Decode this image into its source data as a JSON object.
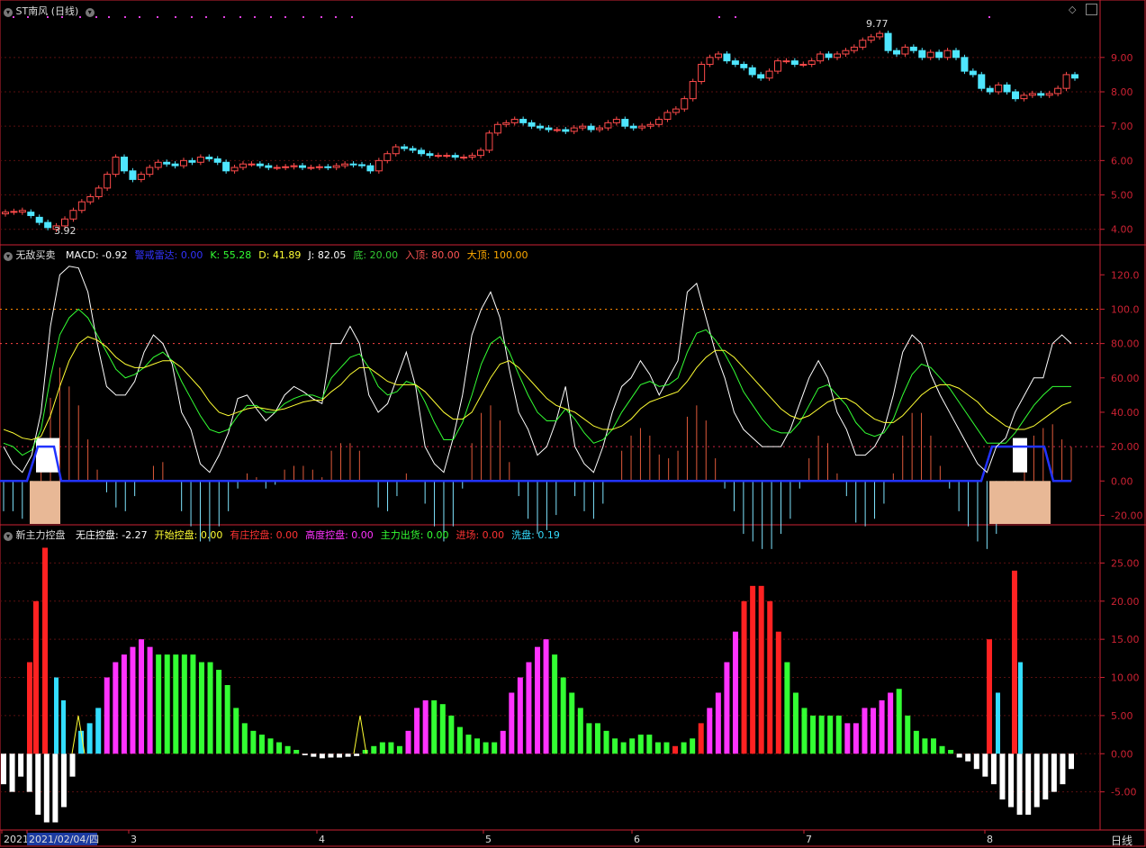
{
  "panel1": {
    "title": "ST南风 (日线)",
    "high_label": "9.77",
    "low_label": "3.92",
    "y_ticks": [
      "9.00",
      "8.00",
      "7.00",
      "6.00",
      "5.00",
      "4.00"
    ]
  },
  "panel2": {
    "name": "无敌买卖",
    "fields": [
      {
        "label": "MACD: -0.92",
        "color": "#ffffff"
      },
      {
        "label": "警戒雷达: 0.00",
        "color": "#3333ff"
      },
      {
        "label": "K: 55.28",
        "color": "#33ff33"
      },
      {
        "label": "D: 41.89",
        "color": "#ffff33"
      },
      {
        "label": "J: 82.05",
        "color": "#ffffff"
      },
      {
        "label": "底: 20.00",
        "color": "#33cc33"
      },
      {
        "label": "入顶: 80.00",
        "color": "#ff5555"
      },
      {
        "label": "大顶: 100.00",
        "color": "#ffaa00"
      }
    ],
    "y_ticks": [
      "120.0",
      "100.0",
      "80.00",
      "60.00",
      "40.00",
      "20.00",
      "0.00",
      "-20.00"
    ]
  },
  "panel3": {
    "name": "新主力控盘",
    "fields": [
      {
        "label": "无庄控盘: -2.27",
        "color": "#ffffff"
      },
      {
        "label": "开始控盘: 0.00",
        "color": "#ffff33"
      },
      {
        "label": "有庄控盘: 0.00",
        "color": "#ff3333"
      },
      {
        "label": "高度控盘: 0.00",
        "color": "#ff33ff"
      },
      {
        "label": "主力出货: 0.00",
        "color": "#33ff33"
      },
      {
        "label": "进场: 0.00",
        "color": "#ff3333"
      },
      {
        "label": "洗盘: 0.19",
        "color": "#33ddff"
      }
    ],
    "y_ticks": [
      "25.00",
      "20.00",
      "15.00",
      "10.00",
      "5.00",
      "0.00",
      "-5.00"
    ]
  },
  "xaxis": {
    "labels": [
      "2021",
      "2021/02/04/四",
      "3",
      "4",
      "5",
      "6",
      "7",
      "8"
    ],
    "period": "日线"
  },
  "chart_data": [
    {
      "type": "candlestick",
      "title": "ST南风 (日线)",
      "ylim": [
        3.6,
        10.2
      ],
      "close": [
        4.5,
        4.52,
        4.55,
        4.4,
        4.2,
        4.05,
        4.1,
        4.3,
        4.55,
        4.8,
        4.95,
        5.2,
        5.6,
        6.1,
        5.7,
        5.45,
        5.6,
        5.8,
        5.95,
        5.9,
        5.85,
        6.0,
        5.95,
        6.1,
        6.05,
        5.95,
        5.7,
        5.8,
        5.9,
        5.9,
        5.85,
        5.8,
        5.8,
        5.82,
        5.85,
        5.8,
        5.8,
        5.82,
        5.8,
        5.85,
        5.9,
        5.88,
        5.85,
        5.7,
        6.0,
        6.2,
        6.4,
        6.35,
        6.3,
        6.2,
        6.15,
        6.15,
        6.15,
        6.1,
        6.1,
        6.15,
        6.3,
        6.8,
        7.05,
        7.1,
        7.2,
        7.1,
        7.0,
        6.95,
        6.9,
        6.9,
        6.85,
        6.95,
        7.0,
        6.9,
        6.95,
        7.1,
        7.2,
        7.0,
        6.95,
        7.0,
        7.05,
        7.2,
        7.4,
        7.5,
        7.8,
        8.3,
        8.8,
        9.0,
        9.1,
        8.9,
        8.8,
        8.7,
        8.5,
        8.4,
        8.6,
        8.9,
        8.9,
        8.8,
        8.8,
        8.9,
        9.1,
        9.0,
        9.1,
        9.2,
        9.3,
        9.5,
        9.6,
        9.7,
        9.2,
        9.1,
        9.3,
        9.2,
        9.0,
        9.15,
        9.0,
        9.2,
        9.0,
        8.6,
        8.5,
        8.1,
        8.0,
        8.2,
        8.0,
        7.8,
        7.9,
        7.95,
        7.9,
        7.95,
        8.1,
        8.5,
        8.4
      ],
      "open": [
        4.45,
        4.5,
        4.5,
        4.5,
        4.35,
        4.2,
        4.0,
        4.1,
        4.3,
        4.55,
        4.8,
        4.95,
        5.2,
        5.6,
        6.1,
        5.7,
        5.45,
        5.6,
        5.8,
        5.95,
        5.9,
        5.85,
        6.0,
        5.95,
        6.1,
        6.05,
        5.95,
        5.7,
        5.8,
        5.9,
        5.9,
        5.85,
        5.8,
        5.8,
        5.82,
        5.85,
        5.8,
        5.8,
        5.82,
        5.8,
        5.85,
        5.9,
        5.88,
        5.85,
        5.7,
        6.0,
        6.2,
        6.4,
        6.35,
        6.3,
        6.2,
        6.15,
        6.15,
        6.15,
        6.1,
        6.1,
        6.15,
        6.3,
        6.8,
        7.05,
        7.1,
        7.2,
        7.1,
        7.0,
        6.95,
        6.9,
        6.9,
        6.85,
        6.95,
        7.0,
        6.9,
        6.95,
        7.1,
        7.2,
        7.0,
        6.95,
        7.0,
        7.05,
        7.2,
        7.4,
        7.5,
        7.8,
        8.3,
        8.8,
        9.0,
        9.1,
        8.9,
        8.8,
        8.7,
        8.5,
        8.4,
        8.6,
        8.9,
        8.9,
        8.8,
        8.8,
        8.9,
        9.1,
        9.0,
        9.1,
        9.2,
        9.3,
        9.5,
        9.6,
        9.7,
        9.2,
        9.1,
        9.3,
        9.2,
        9.0,
        9.15,
        9.0,
        9.2,
        9.0,
        8.6,
        8.5,
        8.1,
        8.0,
        8.2,
        8.0,
        7.8,
        7.9,
        7.95,
        7.9,
        7.95,
        8.1,
        8.5
      ]
    },
    {
      "type": "line",
      "title": "无敌买卖",
      "ylim": [
        -25,
        128
      ],
      "series": [
        {
          "name": "J",
          "values": [
            20,
            10,
            5,
            15,
            40,
            90,
            120,
            125,
            124,
            110,
            80,
            55,
            50,
            50,
            58,
            75,
            85,
            80,
            68,
            40,
            30,
            10,
            5,
            15,
            28,
            48,
            50,
            42,
            35,
            40,
            50,
            55,
            52,
            48,
            45,
            80,
            80,
            90,
            80,
            50,
            40,
            45,
            60,
            75,
            55,
            20,
            10,
            5,
            25,
            50,
            85,
            100,
            110,
            95,
            65,
            40,
            30,
            15,
            20,
            35,
            55,
            20,
            10,
            5,
            20,
            40,
            55,
            60,
            70,
            62,
            50,
            60,
            70,
            110,
            115,
            95,
            75,
            60,
            40,
            30,
            25,
            20,
            20,
            20,
            30,
            45,
            60,
            70,
            60,
            40,
            30,
            15,
            15,
            20,
            30,
            50,
            75,
            85,
            80,
            62,
            50,
            40,
            30,
            20,
            10,
            5,
            20,
            25,
            40,
            50,
            60,
            60,
            80,
            85,
            80
          ]
        },
        {
          "name": "K",
          "values": [
            22,
            20,
            15,
            18,
            30,
            60,
            85,
            95,
            100,
            95,
            85,
            75,
            65,
            60,
            62,
            66,
            72,
            75,
            70,
            58,
            48,
            38,
            30,
            28,
            30,
            38,
            44,
            44,
            40,
            40,
            45,
            48,
            50,
            50,
            48,
            60,
            66,
            72,
            74,
            66,
            55,
            50,
            52,
            58,
            56,
            46,
            34,
            24,
            24,
            34,
            50,
            68,
            80,
            84,
            75,
            62,
            50,
            40,
            35,
            35,
            42,
            36,
            28,
            22,
            24,
            30,
            40,
            48,
            56,
            58,
            55,
            56,
            60,
            75,
            86,
            88,
            82,
            74,
            64,
            52,
            44,
            36,
            30,
            28,
            28,
            34,
            44,
            54,
            56,
            50,
            44,
            34,
            28,
            26,
            28,
            36,
            50,
            62,
            68,
            66,
            60,
            54,
            46,
            38,
            30,
            22,
            22,
            22,
            28,
            36,
            44,
            50,
            55,
            55,
            55
          ]
        },
        {
          "name": "D",
          "values": [
            30,
            28,
            25,
            24,
            26,
            38,
            55,
            70,
            80,
            84,
            82,
            78,
            72,
            68,
            66,
            66,
            68,
            70,
            70,
            66,
            60,
            54,
            46,
            40,
            38,
            40,
            42,
            43,
            42,
            41,
            42,
            44,
            46,
            47,
            47,
            52,
            56,
            62,
            66,
            66,
            62,
            58,
            56,
            56,
            56,
            52,
            46,
            40,
            36,
            36,
            40,
            50,
            60,
            68,
            70,
            66,
            60,
            54,
            48,
            44,
            42,
            40,
            36,
            32,
            30,
            30,
            32,
            36,
            42,
            46,
            48,
            50,
            52,
            58,
            66,
            72,
            76,
            76,
            72,
            66,
            60,
            54,
            48,
            42,
            38,
            36,
            38,
            42,
            46,
            48,
            48,
            45,
            40,
            36,
            34,
            34,
            38,
            44,
            50,
            54,
            56,
            56,
            54,
            50,
            46,
            40,
            36,
            32,
            30,
            30,
            32,
            36,
            40,
            44,
            46
          ]
        }
      ],
      "ref_lines": {
        "底": 20,
        "入顶": 80,
        "大顶": 100
      }
    },
    {
      "type": "bar",
      "title": "新主力控盘",
      "ylim": [
        -10,
        28
      ],
      "values": [
        -4,
        -5,
        -3,
        -5,
        -8,
        -9,
        -9,
        -7,
        -3,
        3,
        4,
        6,
        10,
        12,
        13,
        14,
        15,
        14,
        13,
        13,
        13,
        13,
        13,
        12,
        12,
        11,
        9,
        6,
        4,
        3,
        2.5,
        2,
        1.5,
        1,
        0.5,
        -0.2,
        -0.4,
        -0.6,
        -0.5,
        -0.5,
        -0.4,
        -0.3,
        0.5,
        1,
        1.5,
        1.5,
        1,
        3,
        6,
        7,
        7,
        6.5,
        5,
        3.5,
        2.5,
        2,
        1.5,
        1.5,
        3,
        8,
        10,
        12,
        14,
        15,
        13,
        10,
        8,
        6,
        4,
        4,
        3,
        2,
        1.5,
        2,
        2.5,
        2.5,
        1.5,
        1.5,
        1,
        1.5,
        2,
        4,
        6,
        8,
        12,
        16,
        20,
        22,
        22,
        20,
        16,
        12,
        8,
        6,
        5,
        5,
        5,
        5,
        4,
        4,
        6,
        6,
        7,
        8,
        8.5,
        5,
        3,
        2,
        2,
        1,
        0.5,
        -0.5,
        -1,
        -2,
        -3,
        -4,
        -6,
        -7,
        -8,
        -8,
        -7,
        -6,
        -5,
        -4,
        -2
      ]
    }
  ]
}
